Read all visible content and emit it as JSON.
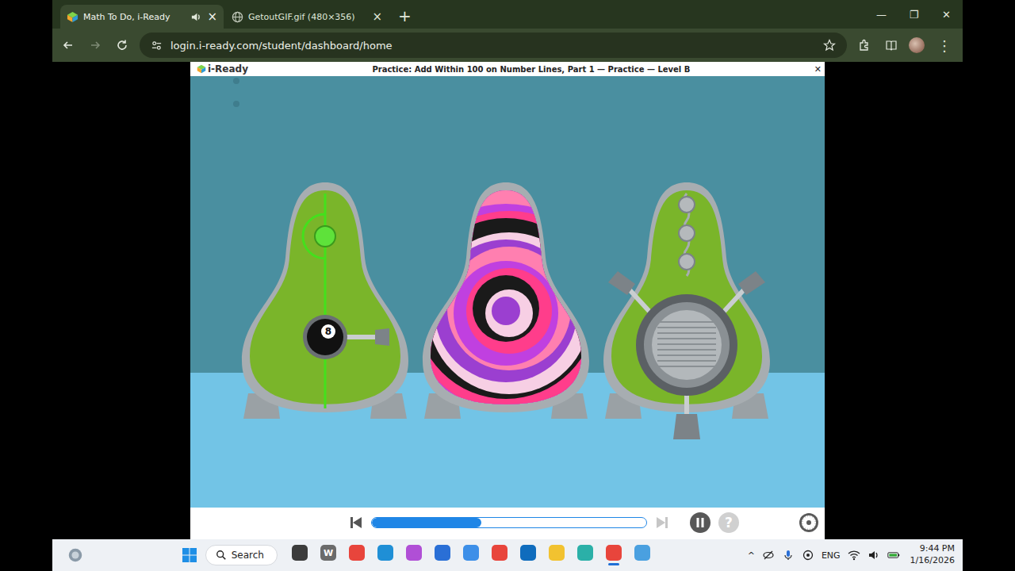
{
  "browser": {
    "tabs": [
      {
        "label": "Math To Do, i-Ready",
        "selected": true,
        "playing_audio": true,
        "close": "×"
      },
      {
        "label": "GetoutGIF.gif (480×356)",
        "selected": false,
        "playing_audio": false,
        "close": "×"
      }
    ],
    "new_tab": "+",
    "window_controls": [
      "—",
      "❐",
      "✕"
    ],
    "url": "login.i-ready.com/student/dashboard/home",
    "menu": "⋮"
  },
  "lesson": {
    "logo": "i-Ready",
    "title": "Practice: Add Within 100 on Number Lines, Part 1 — Practice — Level B",
    "close": "✕",
    "progress": {
      "level": 0.4
    },
    "help": "?"
  },
  "game": {
    "pods": [
      {
        "kind": "switch",
        "ball_label": "8"
      },
      {
        "kind": "portal"
      },
      {
        "kind": "vault"
      }
    ]
  },
  "taskbar": {
    "search": "Search",
    "apps": [
      {
        "color": "#3c3c3c",
        "active": false
      },
      {
        "color": "#6b6b6b",
        "label": "W",
        "active": false
      },
      {
        "color": "#e8453c",
        "active": false
      },
      {
        "color": "#1f8fd6",
        "active": false
      },
      {
        "color": "#b04fd6",
        "active": false
      },
      {
        "color": "#2a6fd6",
        "active": false
      },
      {
        "color": "#3d8fe8",
        "active": false
      },
      {
        "color": "#e8453c",
        "active": false
      },
      {
        "color": "#0f6cbd",
        "active": false
      },
      {
        "color": "#f2c230",
        "active": false
      },
      {
        "color": "#2bb0a8",
        "active": false
      },
      {
        "color": "#e8453c",
        "active": true
      },
      {
        "color": "#4aa0e0",
        "active": false
      }
    ],
    "tray": {
      "overflow": "^",
      "language": "ENG",
      "time": "9:44 PM",
      "date": "1/16/2026"
    }
  }
}
